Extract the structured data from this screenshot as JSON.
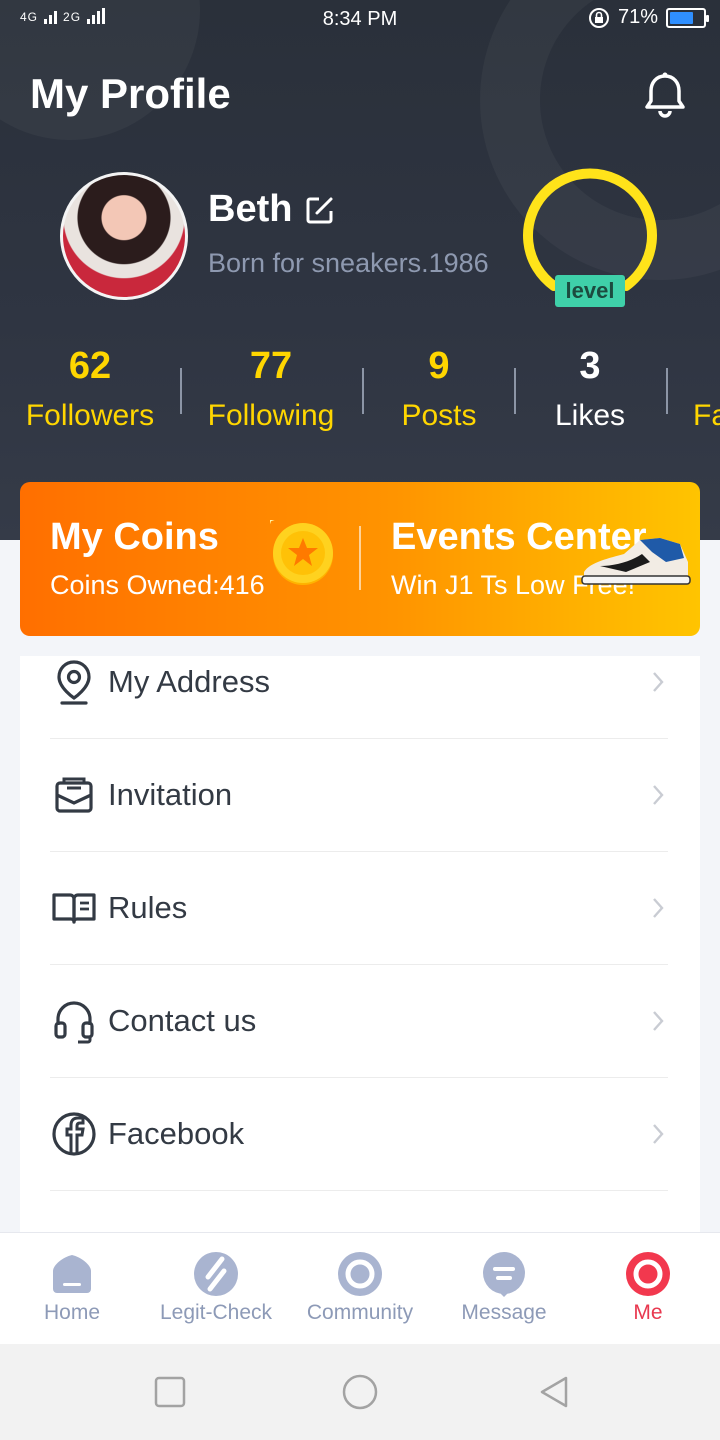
{
  "status_bar": {
    "network_left": "4G",
    "network_right": "2G",
    "time": "8:34 PM",
    "battery": "71%",
    "battery_level": 0.71
  },
  "header": {
    "title": "My Profile"
  },
  "profile": {
    "name": "Beth",
    "bio": "Born for sneakers.1986",
    "level_label": "level"
  },
  "stats": [
    {
      "value": "62",
      "label": "Followers"
    },
    {
      "value": "77",
      "label": "Following"
    },
    {
      "value": "9",
      "label": "Posts"
    },
    {
      "value": "3",
      "label": "Likes"
    },
    {
      "value": "",
      "label": "Fa"
    }
  ],
  "banner": {
    "coins_title": "My Coins",
    "coins_sub": "Coins Owned:416",
    "events_title": "Events Center",
    "events_sub": "Win J1 Ts Low Free!"
  },
  "menu": [
    {
      "label": "My Address",
      "icon": "location-pin-icon"
    },
    {
      "label": "Invitation",
      "icon": "envelope-icon"
    },
    {
      "label": "Rules",
      "icon": "book-icon"
    },
    {
      "label": "Contact us",
      "icon": "headset-icon"
    },
    {
      "label": "Facebook",
      "icon": "facebook-icon"
    }
  ],
  "tabs": [
    {
      "label": "Home",
      "icon": "home-icon"
    },
    {
      "label": "Legit-Check",
      "icon": "legit-check-icon"
    },
    {
      "label": "Community",
      "icon": "community-icon"
    },
    {
      "label": "Message",
      "icon": "message-icon"
    },
    {
      "label": "Me",
      "icon": "me-icon",
      "active": true
    }
  ],
  "colors": {
    "accent": "#ffd600",
    "active_tab": "#e8384f",
    "tab_inactive": "#8d9ab7",
    "level_badge": "#3fd0a9"
  }
}
